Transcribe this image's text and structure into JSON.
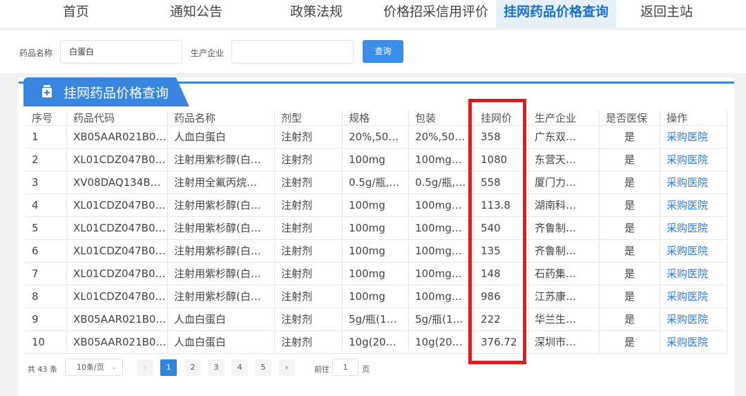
{
  "nav": {
    "items": [
      {
        "label": "首页"
      },
      {
        "label": "通知公告"
      },
      {
        "label": "政策法规"
      },
      {
        "label": "价格招采信用评价"
      },
      {
        "label": "挂网药品价格查询"
      },
      {
        "label": "返回主站"
      }
    ],
    "active_index": 4
  },
  "search": {
    "drug_name_label": "药品名称",
    "drug_name_value": "白蛋白",
    "manufacturer_label": "生产企业",
    "manufacturer_value": "",
    "search_button": "查询"
  },
  "panel": {
    "title": "挂网药品价格查询",
    "accent_color": "#3a86df"
  },
  "table": {
    "headers": [
      "序号",
      "药品代码",
      "药品名称",
      "剂型",
      "规格",
      "包装",
      "挂网价",
      "生产企业",
      "是否医保",
      "操作"
    ],
    "rows": [
      [
        "1",
        "XB05AAR021B0…",
        "人血白蛋白",
        "注射剂",
        "20%,50…",
        "20%,50…",
        "358",
        "广东双…",
        "是",
        "采购医院"
      ],
      [
        "2",
        "XL01CDZ047B0…",
        "注射用紫杉醇(白…",
        "注射剂",
        "100mg",
        "100mg…",
        "1080",
        "东营天…",
        "是",
        "采购医院"
      ],
      [
        "3",
        "XV08DAQ134B0…",
        "注射用全氟丙烷…",
        "注射剂",
        "0.5g/瓶,…",
        "0.5g/瓶,…",
        "558",
        "厦门力…",
        "是",
        "采购医院"
      ],
      [
        "4",
        "XL01CDZ047B0…",
        "注射用紫杉醇(白…",
        "注射剂",
        "100mg",
        "100mg…",
        "113.8",
        "湖南科…",
        "是",
        "采购医院"
      ],
      [
        "5",
        "XL01CDZ047B0…",
        "注射用紫杉醇(白…",
        "注射剂",
        "100mg",
        "100mg…",
        "540",
        "齐鲁制…",
        "是",
        "采购医院"
      ],
      [
        "6",
        "XL01CDZ047B0…",
        "注射用紫杉醇(白…",
        "注射剂",
        "100mg",
        "100mg…",
        "135",
        "齐鲁制…",
        "是",
        "采购医院"
      ],
      [
        "7",
        "XL01CDZ047B0…",
        "注射用紫杉醇(白…",
        "注射剂",
        "100mg",
        "100mg…",
        "148",
        "石药集…",
        "是",
        "采购医院"
      ],
      [
        "8",
        "XL01CDZ047B0…",
        "注射用紫杉醇(白…",
        "注射剂",
        "100mg",
        "100mg…",
        "986",
        "江苏康…",
        "是",
        "采购医院"
      ],
      [
        "9",
        "XB05AAR021B0…",
        "人血白蛋白",
        "注射剂",
        "5g/瓶(1…",
        "5g/瓶(1…",
        "222",
        "华兰生…",
        "是",
        "采购医院"
      ],
      [
        "10",
        "XB05AAR021B0…",
        "人血白蛋白",
        "注射剂",
        "10g(20…",
        "10g(20…",
        "376.72",
        "深圳市…",
        "是",
        "采购医院"
      ]
    ],
    "link_color": "#2a7ad8",
    "highlight_color": "#d42020"
  },
  "pager": {
    "total": "共 43 条",
    "page_size": "10条/页",
    "prev": "‹",
    "pages": [
      "1",
      "2",
      "3",
      "4",
      "5"
    ],
    "next": "›",
    "current_page": "1",
    "goto_label": "前往",
    "goto_value": "1",
    "page_label": "页"
  }
}
